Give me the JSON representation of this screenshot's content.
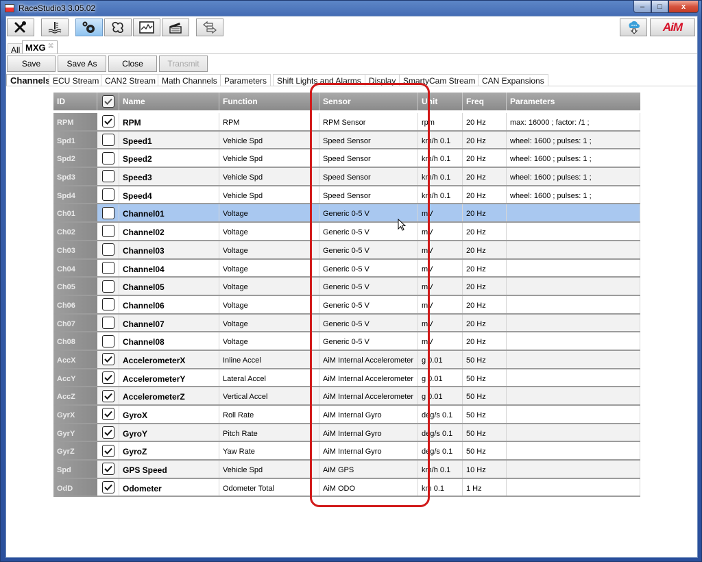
{
  "window": {
    "title": "RaceStudio3 3.05.02",
    "controls": {
      "minimize": "–",
      "maximize": "□",
      "close": "x"
    }
  },
  "toolbar": {
    "buttons": [
      {
        "name": "settings",
        "icon": "wrench-screwdriver-icon",
        "active": false
      },
      {
        "name": "water-temperature",
        "icon": "thermometer-wave-icon",
        "active": false
      },
      {
        "name": "configurations",
        "icon": "gears-icon",
        "active": true
      },
      {
        "name": "tracks",
        "icon": "track-map-icon",
        "active": false
      },
      {
        "name": "data-analysis",
        "icon": "graph-icon",
        "active": false
      },
      {
        "name": "video",
        "icon": "clapperboard-icon",
        "active": false
      },
      {
        "name": "transfer",
        "icon": "transfer-arrows-icon",
        "active": false
      }
    ],
    "right": [
      {
        "name": "cloud-download",
        "icon": "cloud-download-icon"
      },
      {
        "name": "aim-logo",
        "label": "AiM"
      }
    ]
  },
  "device_tabs": {
    "all_label": "All",
    "active_label": "MXG",
    "close_glyph": "⌘"
  },
  "actions": {
    "save": "Save",
    "save_as": "Save As",
    "close": "Close",
    "transmit": "Transmit"
  },
  "config_tabs": [
    {
      "label": "Channels",
      "active": true
    },
    {
      "label": "ECU Stream"
    },
    {
      "label": "CAN2 Stream"
    },
    {
      "label": "Math Channels"
    },
    {
      "label": "Parameters"
    },
    {
      "label": "Shift Lights and Alarms"
    },
    {
      "label": "Display"
    },
    {
      "label": "SmartyCam Stream"
    },
    {
      "label": "CAN Expansions"
    }
  ],
  "grid": {
    "headers": {
      "id": "ID",
      "name": "Name",
      "function": "Function",
      "sensor": "Sensor",
      "unit": "Unit",
      "freq": "Freq",
      "parameters": "Parameters"
    },
    "header_checked": true,
    "rows": [
      {
        "id": "RPM",
        "checked": true,
        "name": "RPM",
        "function": "RPM",
        "sensor": "RPM Sensor",
        "unit": "rpm",
        "freq": "20 Hz",
        "parameters": "max: 16000 ;  factor: /1 ;"
      },
      {
        "id": "Spd1",
        "checked": false,
        "name": "Speed1",
        "function": "Vehicle Spd",
        "sensor": "Speed Sensor",
        "unit": "km/h 0.1",
        "freq": "20 Hz",
        "parameters": "wheel: 1600 ;  pulses: 1 ;"
      },
      {
        "id": "Spd2",
        "checked": false,
        "name": "Speed2",
        "function": "Vehicle Spd",
        "sensor": "Speed Sensor",
        "unit": "km/h 0.1",
        "freq": "20 Hz",
        "parameters": "wheel: 1600 ;  pulses: 1 ;"
      },
      {
        "id": "Spd3",
        "checked": false,
        "name": "Speed3",
        "function": "Vehicle Spd",
        "sensor": "Speed Sensor",
        "unit": "km/h 0.1",
        "freq": "20 Hz",
        "parameters": "wheel: 1600 ;  pulses: 1 ;"
      },
      {
        "id": "Spd4",
        "checked": false,
        "name": "Speed4",
        "function": "Vehicle Spd",
        "sensor": "Speed Sensor",
        "unit": "km/h 0.1",
        "freq": "20 Hz",
        "parameters": "wheel: 1600 ;  pulses: 1 ;"
      },
      {
        "id": "Ch01",
        "checked": false,
        "name": "Channel01",
        "function": "Voltage",
        "sensor": "Generic 0-5 V",
        "unit": "mV",
        "freq": "20 Hz",
        "parameters": "",
        "selected": true
      },
      {
        "id": "Ch02",
        "checked": false,
        "name": "Channel02",
        "function": "Voltage",
        "sensor": "Generic 0-5 V",
        "unit": "mV",
        "freq": "20 Hz",
        "parameters": ""
      },
      {
        "id": "Ch03",
        "checked": false,
        "name": "Channel03",
        "function": "Voltage",
        "sensor": "Generic 0-5 V",
        "unit": "mV",
        "freq": "20 Hz",
        "parameters": ""
      },
      {
        "id": "Ch04",
        "checked": false,
        "name": "Channel04",
        "function": "Voltage",
        "sensor": "Generic 0-5 V",
        "unit": "mV",
        "freq": "20 Hz",
        "parameters": ""
      },
      {
        "id": "Ch05",
        "checked": false,
        "name": "Channel05",
        "function": "Voltage",
        "sensor": "Generic 0-5 V",
        "unit": "mV",
        "freq": "20 Hz",
        "parameters": ""
      },
      {
        "id": "Ch06",
        "checked": false,
        "name": "Channel06",
        "function": "Voltage",
        "sensor": "Generic 0-5 V",
        "unit": "mV",
        "freq": "20 Hz",
        "parameters": ""
      },
      {
        "id": "Ch07",
        "checked": false,
        "name": "Channel07",
        "function": "Voltage",
        "sensor": "Generic 0-5 V",
        "unit": "mV",
        "freq": "20 Hz",
        "parameters": ""
      },
      {
        "id": "Ch08",
        "checked": false,
        "name": "Channel08",
        "function": "Voltage",
        "sensor": "Generic 0-5 V",
        "unit": "mV",
        "freq": "20 Hz",
        "parameters": ""
      },
      {
        "id": "AccX",
        "checked": true,
        "name": "AccelerometerX",
        "function": "Inline Accel",
        "sensor": "AiM Internal Accelerometer",
        "unit": "g 0.01",
        "freq": "50 Hz",
        "parameters": ""
      },
      {
        "id": "AccY",
        "checked": true,
        "name": "AccelerometerY",
        "function": "Lateral Accel",
        "sensor": "AiM Internal Accelerometer",
        "unit": "g 0.01",
        "freq": "50 Hz",
        "parameters": ""
      },
      {
        "id": "AccZ",
        "checked": true,
        "name": "AccelerometerZ",
        "function": "Vertical Accel",
        "sensor": "AiM Internal Accelerometer",
        "unit": "g 0.01",
        "freq": "50 Hz",
        "parameters": ""
      },
      {
        "id": "GyrX",
        "checked": true,
        "name": "GyroX",
        "function": "Roll Rate",
        "sensor": "AiM Internal Gyro",
        "unit": "deg/s 0.1",
        "freq": "50 Hz",
        "parameters": ""
      },
      {
        "id": "GyrY",
        "checked": true,
        "name": "GyroY",
        "function": "Pitch Rate",
        "sensor": "AiM Internal Gyro",
        "unit": "deg/s 0.1",
        "freq": "50 Hz",
        "parameters": ""
      },
      {
        "id": "GyrZ",
        "checked": true,
        "name": "GyroZ",
        "function": "Yaw Rate",
        "sensor": "AiM Internal Gyro",
        "unit": "deg/s 0.1",
        "freq": "50 Hz",
        "parameters": ""
      },
      {
        "id": "Spd",
        "checked": true,
        "name": "GPS Speed",
        "function": "Vehicle Spd",
        "sensor": "AiM GPS",
        "unit": "km/h 0.1",
        "freq": "10 Hz",
        "parameters": ""
      },
      {
        "id": "OdD",
        "checked": true,
        "name": "Odometer",
        "function": "Odometer Total",
        "sensor": "AiM ODO",
        "unit": "km 0.1",
        "freq": "1 Hz",
        "parameters": ""
      }
    ]
  },
  "annotation": {
    "highlighted_column": "Sensor",
    "color": "#d11a1a"
  },
  "colors": {
    "selected_row": "#a9c8f0",
    "header_bg": "#8a8a8a",
    "active_toolbar": "#8fc3ef",
    "brand_red": "#d6132a"
  }
}
